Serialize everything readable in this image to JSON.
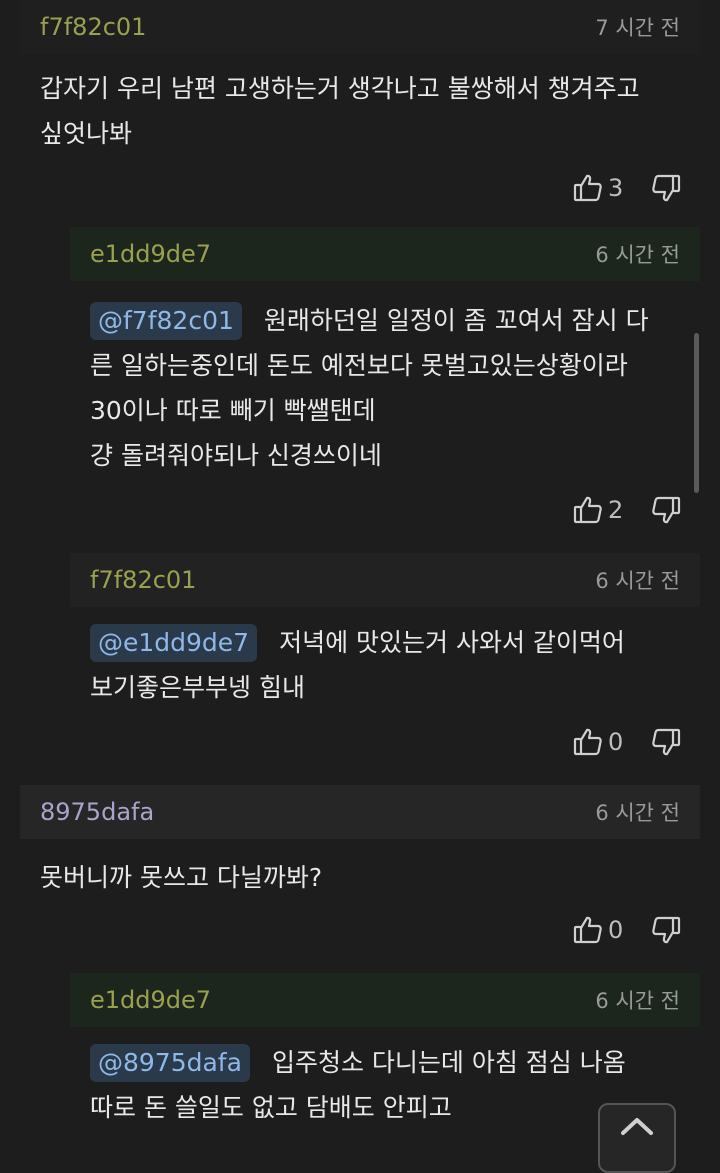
{
  "comments": [
    {
      "user": "f7f82c01",
      "time": "7 시간 전",
      "lines": [
        "갑자기 우리 남편 고생하는거 생각나고 불쌍해서 챙겨주고",
        "싶엇나봐"
      ],
      "likes": "3"
    },
    {
      "user": "e1dd9de7",
      "time": "6 시간 전",
      "mention": "@f7f82c01",
      "lines": [
        "원래하던일 일정이 좀 꼬여서 잠시 다",
        "른 일하는중인데 돈도 예전보다 못벌고있는상황이라",
        "30이나 따로 빼기 빡쌜탠데",
        "걍 돌려줘야되나 신경쓰이네"
      ],
      "likes": "2"
    },
    {
      "user": "f7f82c01",
      "time": "6 시간 전",
      "mention": "@e1dd9de7",
      "lines": [
        "저녁에 맛있는거 사와서 같이먹어",
        "보기좋은부부넹 힘내"
      ],
      "likes": "0"
    },
    {
      "user": "8975dafa",
      "time": "6 시간 전",
      "lines": [
        "못버니까 못쓰고 다닐까봐?"
      ],
      "likes": "0"
    },
    {
      "user": "e1dd9de7",
      "time": "6 시간 전",
      "mention": "@8975dafa",
      "lines": [
        "입주청소 다니는데 아침 점심 나옴",
        "따로 돈 쓸일도 없고 담배도 안피고"
      ],
      "likes": ""
    }
  ],
  "icons": {
    "like": "thumbs-up-icon",
    "dislike": "thumbs-down-icon",
    "top": "chevron-up-icon"
  },
  "colors": {
    "background": "#1d1d1d",
    "mention_bg": "#2a3a4a",
    "mention_text": "#8fb7e8",
    "user_olive": "#9aa04f",
    "user_purple": "#aba3cc",
    "reply_header_green": "#1c261c"
  }
}
